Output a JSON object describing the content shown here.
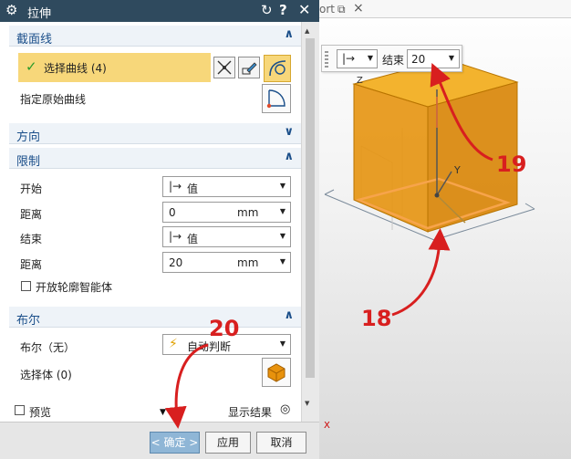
{
  "title_bar": {
    "title": "拉伸"
  },
  "tab": {
    "text": "ort"
  },
  "mini_toolbar": {
    "type_symbol": "|→",
    "label": "结束",
    "value": "20"
  },
  "sections": {
    "section_curve": {
      "title": "截面线",
      "select_label": "选择曲线 (4)",
      "original_curve_label": "指定原始曲线"
    },
    "direction": {
      "title": "方向"
    },
    "limits": {
      "title": "限制",
      "start_label": "开始",
      "start_value": "值",
      "start_symbol": "|→",
      "start_dist_label": "距离",
      "start_dist_value": "0",
      "start_dist_unit": "mm",
      "end_label": "结束",
      "end_value": "值",
      "end_symbol": "|→",
      "end_dist_label": "距离",
      "end_dist_value": "20",
      "end_dist_unit": "mm",
      "open_profile_label": "开放轮廓智能体"
    },
    "boolean": {
      "title": "布尔",
      "bool_label": "布尔（无）",
      "bool_value": "自动判断",
      "select_body_label": "选择体 (0)"
    },
    "cut_row": {
      "preview_label": "预览",
      "show_result_label": "显示结果"
    }
  },
  "footer": {
    "ok": "< 确定 >",
    "apply": "应用",
    "cancel": "取消"
  },
  "scene": {
    "axis_z": "Z",
    "axis_y": "Y",
    "axis_x": "X"
  },
  "annotations": {
    "callout_18": "18",
    "callout_19": "19",
    "callout_20": "20"
  },
  "colors": {
    "title_bar": "#2f4a5e",
    "section_text": "#1b4f8a",
    "highlight": "#f7d77a",
    "solid": "#e8920c",
    "callout": "#d81f1f"
  }
}
